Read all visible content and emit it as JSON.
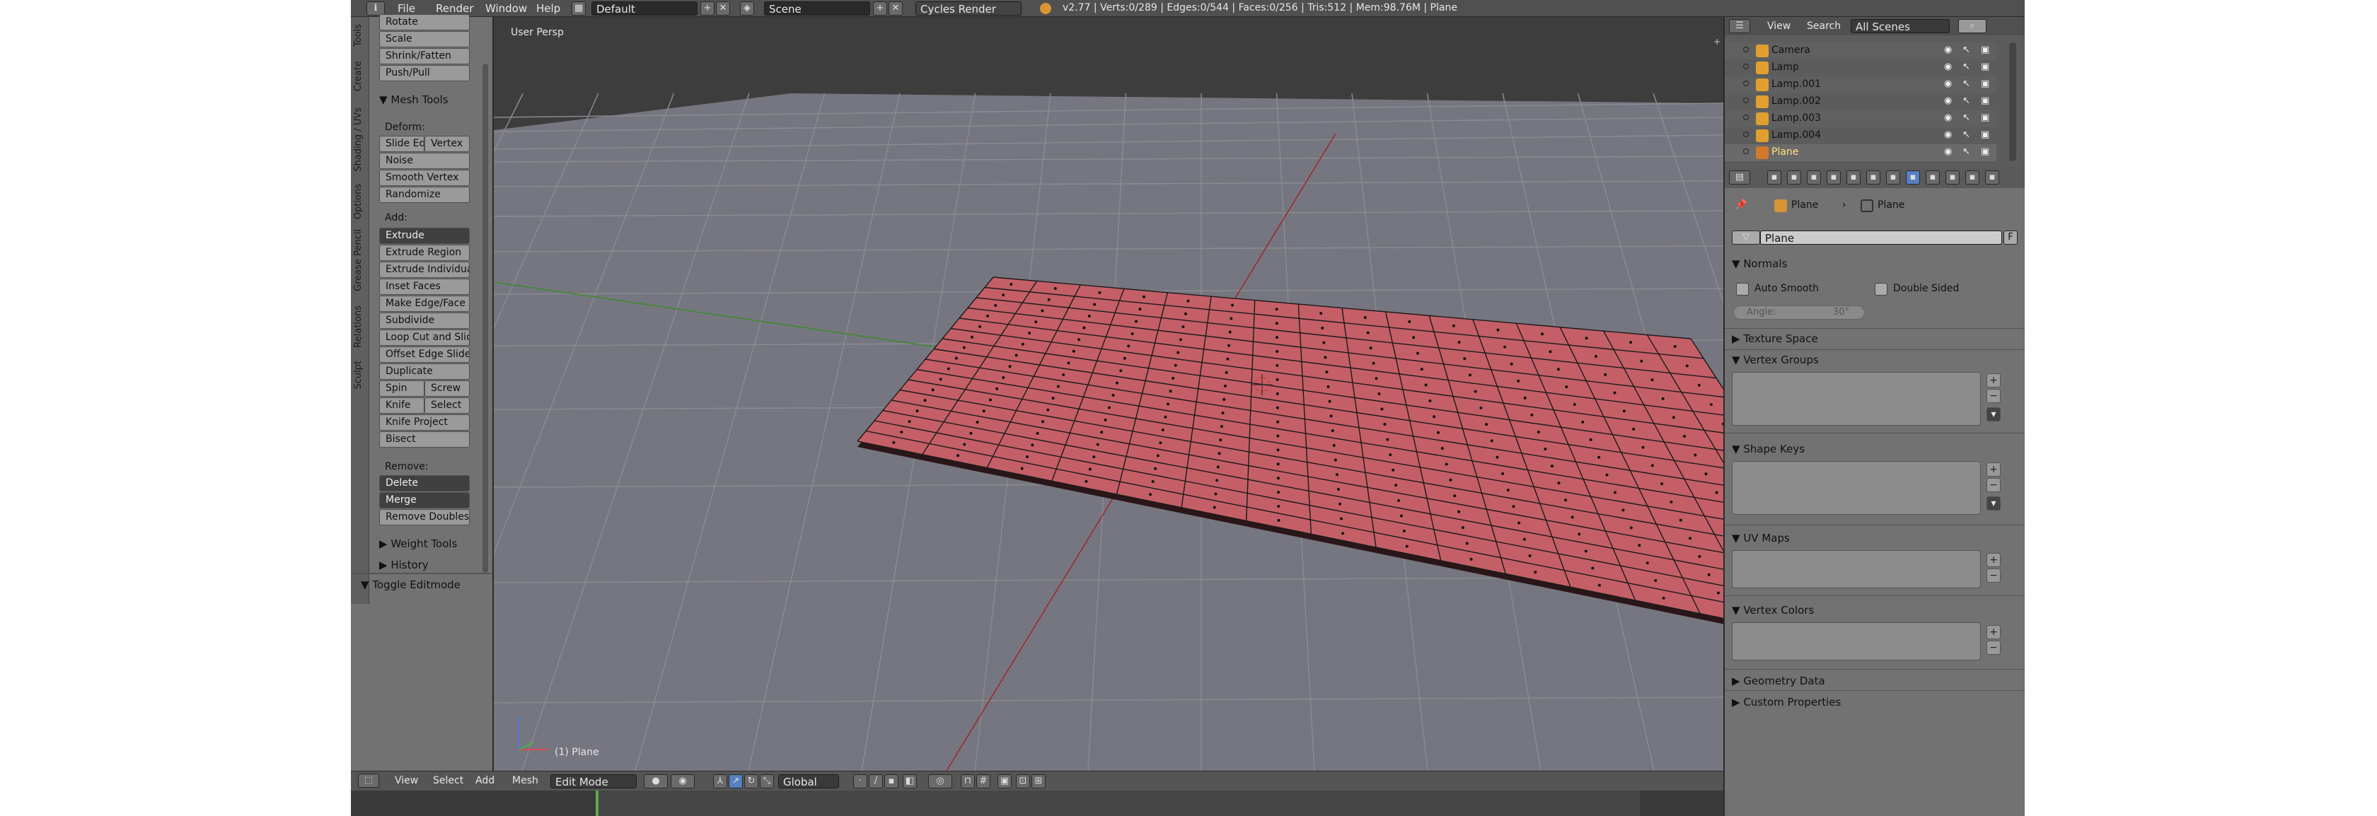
{
  "topbar": {
    "menus": [
      "File",
      "Render",
      "Window",
      "Help"
    ],
    "screen_layout": "Default",
    "scene": "Scene",
    "render_engine": "Cycles Render",
    "stats": "v2.77 | Verts:0/289 | Edges:0/544 | Faces:0/256 | Tris:512 | Mem:98.76M | Plane"
  },
  "toolshelf": {
    "tabs": [
      "Tools",
      "Create",
      "Shading / UVs",
      "Options",
      "Grease Pencil",
      "Relations",
      "Sculpt"
    ],
    "top_buttons": [
      "Rotate",
      "Scale",
      "Shrink/Fatten",
      "Push/Pull"
    ],
    "mesh_tools_header": "Mesh Tools",
    "deform_label": "Deform:",
    "slide_edge": "Slide Ed",
    "vertex": "Vertex",
    "noise": "Noise",
    "smooth_vertex": "Smooth Vertex",
    "randomize": "Randomize",
    "add_label": "Add:",
    "extrude": "Extrude",
    "extrude_region": "Extrude Region",
    "extrude_individual": "Extrude Individual",
    "inset_faces": "Inset Faces",
    "make_edge_face": "Make Edge/Face",
    "subdivide": "Subdivide",
    "loop_cut": "Loop Cut and Slide",
    "offset_edge": "Offset Edge Slide",
    "duplicate": "Duplicate",
    "spin": "Spin",
    "screw": "Screw",
    "knife": "Knife",
    "select": "Select",
    "knife_project": "Knife Project",
    "bisect": "Bisect",
    "remove_label": "Remove:",
    "delete": "Delete",
    "merge": "Merge",
    "remove_doubles": "Remove Doubles",
    "weight_tools": "Weight Tools",
    "history": "History",
    "toggle_editmode": "Toggle Editmode"
  },
  "viewport": {
    "view_label": "User Persp",
    "object_label": "(1) Plane",
    "header_menus": [
      "View",
      "Select",
      "Add",
      "Mesh"
    ],
    "mode": "Edit Mode",
    "orientation": "Global",
    "plane_color": "#c45f67",
    "grid_color": "#888888",
    "bg_top": "#3c3c3c",
    "bg_bottom": "#7a7a7a"
  },
  "outliner": {
    "view": "View",
    "search": "Search",
    "scenes": "All Scenes",
    "items": [
      "Camera",
      "Lamp",
      "Lamp.001",
      "Lamp.002",
      "Lamp.003",
      "Lamp.004",
      "Plane"
    ]
  },
  "properties": {
    "breadcrumb_object": "Plane",
    "breadcrumb_mesh": "Plane",
    "mesh_name": "Plane",
    "fake_user": "F",
    "normals": "Normals",
    "auto_smooth": "Auto Smooth",
    "double_sided": "Double Sided",
    "angle_label": "Angle:",
    "angle_value": "30°",
    "texture_space": "Texture Space",
    "vertex_groups": "Vertex Groups",
    "shape_keys": "Shape Keys",
    "uv_maps": "UV Maps",
    "vertex_colors": "Vertex Colors",
    "geometry_data": "Geometry Data",
    "custom_properties": "Custom Properties"
  }
}
